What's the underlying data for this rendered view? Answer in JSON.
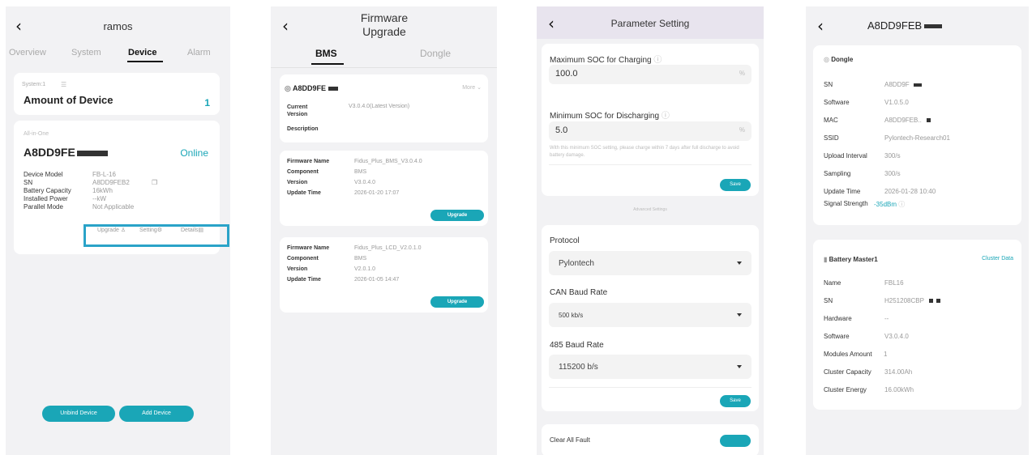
{
  "screen1": {
    "title": "ramos",
    "tabs": [
      "Overview",
      "System",
      "Device",
      "Alarm"
    ],
    "system_label": "System:1",
    "amount_label": "Amount of Device",
    "amount_value": "1",
    "device_type": "All-in-One",
    "device_name": "A8DD9FE",
    "status": "Online",
    "fields": [
      {
        "label": "Device Model",
        "value": "FB-L-16"
      },
      {
        "label": "SN",
        "value": "A8DD9FEB2"
      },
      {
        "label": "Battery Capacity",
        "value": "16kWh"
      },
      {
        "label": "Installed Power",
        "value": "--kW"
      },
      {
        "label": "Parallel Mode",
        "value": "Not Applicable"
      }
    ],
    "actions": [
      "Upgrade",
      "Setting",
      "Details"
    ],
    "unbind_label": "Unbind Device",
    "add_label": "Add Device",
    "highlight_color": "#2aa3c8"
  },
  "screen2": {
    "title_line1": "Firmware",
    "title_line2": "Upgrade",
    "tab_bms": "BMS",
    "tab_dongle": "Dongle",
    "device_id": "A8DD9FE",
    "more_label": "More",
    "current_version_label": "Current Version",
    "current_version_value": "V3.0.4.0(Latest Version)",
    "description_label": "Description",
    "firmware": [
      {
        "fields": [
          {
            "label": "Firmware Name",
            "value": "Fidus_Plus_BMS_V3.0.4.0"
          },
          {
            "label": "Component",
            "value": "BMS"
          },
          {
            "label": "Version",
            "value": "V3.0.4.0"
          },
          {
            "label": "Update Time",
            "value": "2026-01-20 17:07"
          }
        ],
        "button": "Upgrade"
      },
      {
        "fields": [
          {
            "label": "Firmware Name",
            "value": "Fidus_Plus_LCD_V2.0.1.0"
          },
          {
            "label": "Component",
            "value": "BMS"
          },
          {
            "label": "Version",
            "value": "V2.0.1.0"
          },
          {
            "label": "Update Time",
            "value": "2026-01-05 14:47"
          }
        ],
        "button": "Upgrade"
      }
    ]
  },
  "screen3": {
    "title": "Parameter Setting",
    "max_soc_label": "Maximum SOC for Charging",
    "max_soc_value": "100.0",
    "min_soc_label": "Minimum SOC for Discharging",
    "min_soc_value": "5.0",
    "percent": "%",
    "hint": "With this minimum SOC setting, please charge within 7 days after full discharge to avoid battery damage.",
    "save_label": "Save",
    "advanced_label": "Advanced Settings",
    "protocol_label": "Protocol",
    "protocol_value": "Pylontech",
    "can_label": "CAN Baud Rate",
    "can_value": "500 kb/s",
    "rs485_label": "485 Baud Rate",
    "rs485_value": "115200 b/s",
    "save2_label": "Save",
    "clear_label": "Clear All Fault"
  },
  "screen4": {
    "title": "A8DD9FEB",
    "dongle_header": "Dongle",
    "dongle_fields": [
      {
        "label": "SN",
        "value": "A8DD9F"
      },
      {
        "label": "Software",
        "value": "V1.0.5.0"
      },
      {
        "label": "MAC",
        "value": "A8DD9FEB.."
      },
      {
        "label": "SSID",
        "value": "Pylontech-Research01"
      },
      {
        "label": "Upload Interval",
        "value": "300/s"
      },
      {
        "label": "Sampling",
        "value": "300/s"
      },
      {
        "label": "Update Time",
        "value": "2026-01-28 10:40"
      },
      {
        "label": "Signal Strength",
        "value": "-35dBm"
      }
    ],
    "battery_header": "Battery Master1",
    "cluster_link": "Cluster Data",
    "battery_fields": [
      {
        "label": "Name",
        "value": "FBL16"
      },
      {
        "label": "SN",
        "value": "H251208CBP"
      },
      {
        "label": "Hardware",
        "value": "--"
      },
      {
        "label": "Software",
        "value": "V3.0.4.0"
      },
      {
        "label": "Modules Amount",
        "value": "1"
      },
      {
        "label": "Cluster Capacity",
        "value": "314.00Ah"
      },
      {
        "label": "Cluster Energy",
        "value": "16.00kWh"
      }
    ]
  }
}
